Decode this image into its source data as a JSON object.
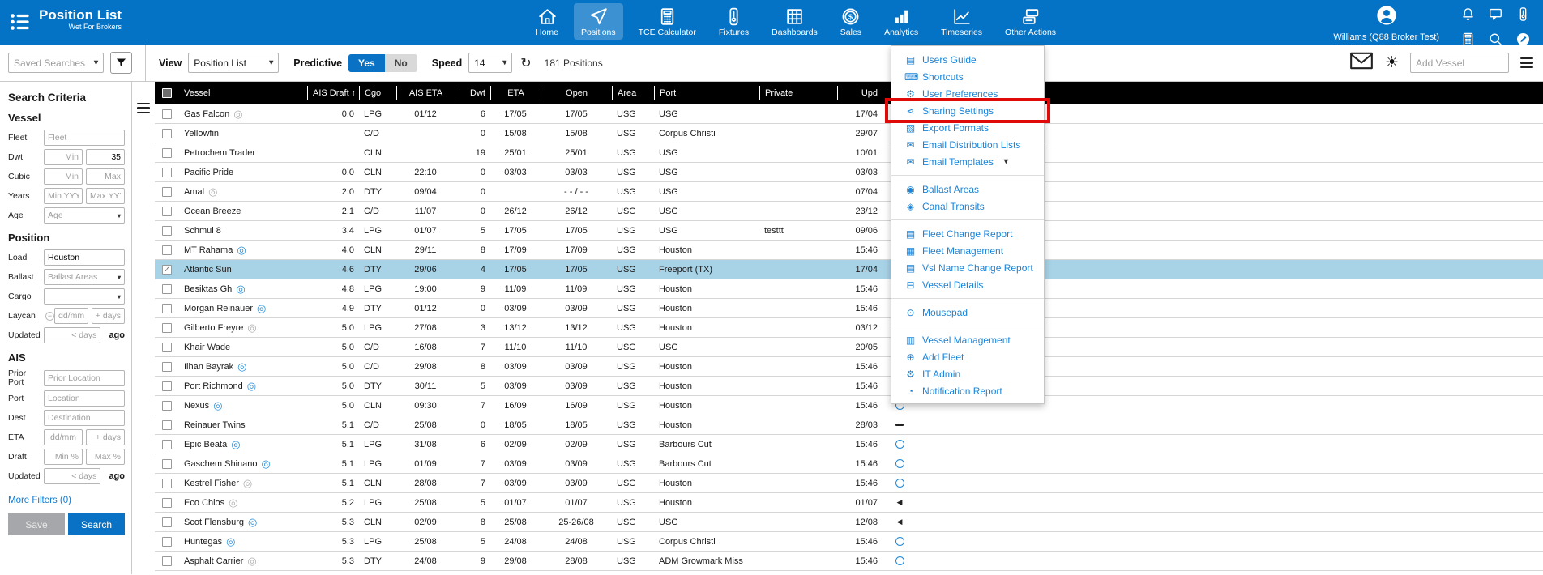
{
  "app": {
    "title": "Position List",
    "subtitle": "Wet For Brokers"
  },
  "nav": {
    "active": "Positions",
    "items": [
      {
        "label": "Home",
        "icon": "home"
      },
      {
        "label": "Positions",
        "icon": "positions"
      },
      {
        "label": "TCE Calculator",
        "icon": "calculator"
      },
      {
        "label": "Fixtures",
        "icon": "fixtures"
      },
      {
        "label": "Dashboards",
        "icon": "dashboards"
      },
      {
        "label": "Sales",
        "icon": "sales"
      },
      {
        "label": "Analytics",
        "icon": "analytics"
      },
      {
        "label": "Timeseries",
        "icon": "timeseries"
      },
      {
        "label": "Other Actions",
        "icon": "other-actions"
      }
    ]
  },
  "user": {
    "name": "Williams (Q88 Broker Test)"
  },
  "toolbar": {
    "saved_searches_placeholder": "Saved Searches",
    "view_label": "View",
    "view_value": "Position List",
    "predictive_label": "Predictive",
    "predictive_yes": "Yes",
    "predictive_no": "No",
    "speed_label": "Speed",
    "speed_value": "14",
    "positions_count": "181 Positions",
    "add_vessel_placeholder": "Add Vessel"
  },
  "sidebar": {
    "title": "Search Criteria",
    "more_filters": "More Filters (0)",
    "save_label": "Save",
    "search_label": "Search",
    "updated_suffix": "ago",
    "sections": [
      {
        "heading": "Vessel",
        "rows": [
          {
            "label": "Fleet",
            "type": "input",
            "placeholder": "Fleet"
          },
          {
            "label": "Dwt",
            "type": "pair",
            "a": {
              "ph": "Min",
              "align": "r"
            },
            "b": {
              "value": "35",
              "align": "r"
            }
          },
          {
            "label": "Cubic",
            "type": "pair",
            "a": {
              "ph": "Min",
              "align": "r"
            },
            "b": {
              "ph": "Max",
              "align": "r"
            }
          },
          {
            "label": "Years",
            "type": "pair",
            "a": {
              "ph": "Min YYYY",
              "align": "c"
            },
            "b": {
              "ph": "Max YYYY",
              "align": "c"
            }
          },
          {
            "label": "Age",
            "type": "select",
            "placeholder": "Age"
          }
        ]
      },
      {
        "heading": "Position",
        "rows": [
          {
            "label": "Load",
            "type": "input",
            "value": "Houston"
          },
          {
            "label": "Ballast",
            "type": "select",
            "placeholder": "Ballast Areas"
          },
          {
            "label": "Cargo",
            "type": "select",
            "placeholder": ""
          },
          {
            "label": "Laycan",
            "type": "pair",
            "badge": "−",
            "a": {
              "ph": "dd/mm",
              "align": "c"
            },
            "b": {
              "ph": "+ days",
              "align": "r"
            }
          },
          {
            "label": "Updated",
            "type": "suffix",
            "a": {
              "ph": "< days",
              "align": "r"
            },
            "suffix": "ago"
          }
        ]
      },
      {
        "heading": "AIS",
        "rows": [
          {
            "label": "Prior Port",
            "type": "input",
            "placeholder": "Prior Location"
          },
          {
            "label": "Port",
            "type": "input",
            "placeholder": "Location"
          },
          {
            "label": "Dest",
            "type": "input",
            "placeholder": "Destination"
          },
          {
            "label": "ETA",
            "type": "pair",
            "a": {
              "ph": "dd/mm",
              "align": "c"
            },
            "b": {
              "ph": "+ days",
              "align": "r"
            }
          },
          {
            "label": "Draft",
            "type": "pair",
            "a": {
              "ph": "Min %",
              "align": "r"
            },
            "b": {
              "ph": "Max %",
              "align": "r"
            }
          },
          {
            "label": "Updated",
            "type": "suffix",
            "a": {
              "ph": "< days",
              "align": "r"
            },
            "suffix": "ago"
          }
        ]
      }
    ]
  },
  "table": {
    "columns": [
      "Vessel",
      "AIS Draft",
      "Cgo",
      "AIS ETA",
      "Dwt",
      "ETA",
      "Open",
      "Area",
      "Port",
      "Private",
      "Upd"
    ],
    "sort_column": "AIS Draft",
    "sort_arrow": "↑",
    "rows": [
      {
        "vessel": "Gas Falcon",
        "live": "grey",
        "draft": "0.0",
        "cgo": "LPG",
        "ais_eta": "01/12",
        "dwt": "6",
        "eta": "17/05",
        "open": "17/05",
        "open_dotted": true,
        "area": "USG",
        "port": "USG",
        "private": "",
        "upd": "17/04",
        "status": "dash",
        "selected": false
      },
      {
        "vessel": "Yellowfin",
        "live": null,
        "draft": "",
        "cgo": "C/D",
        "ais_eta": "",
        "dwt": "0",
        "eta": "15/08",
        "open": "15/08",
        "open_dotted": false,
        "area": "USG",
        "port": "Corpus Christi",
        "private": "",
        "upd": "29/07",
        "status": "dash",
        "selected": false
      },
      {
        "vessel": "Petrochem Trader",
        "live": null,
        "draft": "",
        "cgo": "CLN",
        "ais_eta": "",
        "dwt": "19",
        "eta": "25/01",
        "open": "25/01",
        "open_dotted": false,
        "area": "USG",
        "port": "USG",
        "private": "",
        "upd": "10/01",
        "status": "tri",
        "selected": false
      },
      {
        "vessel": "Pacific Pride",
        "live": null,
        "draft": "0.0",
        "cgo": "CLN",
        "ais_eta": "22:10",
        "dwt": "0",
        "eta": "03/03",
        "open": "03/03",
        "open_dotted": false,
        "area": "USG",
        "port": "USG",
        "private": "",
        "upd": "03/03",
        "status": "tri",
        "selected": false
      },
      {
        "vessel": "Amal",
        "live": "grey",
        "draft": "2.0",
        "cgo": "DTY",
        "ais_eta": "09/04",
        "dwt": "0",
        "eta": "",
        "open": "- - / - -",
        "open_dotted": true,
        "area": "USG",
        "port": "USG",
        "private": "",
        "upd": "07/04",
        "status": "dash",
        "selected": false
      },
      {
        "vessel": "Ocean Breeze",
        "live": null,
        "draft": "2.1",
        "cgo": "C/D",
        "ais_eta": "11/07",
        "dwt": "0",
        "eta": "26/12",
        "open": "26/12",
        "open_dotted": false,
        "area": "USG",
        "port": "USG",
        "private": "",
        "upd": "23/12",
        "status": "tri",
        "selected": false
      },
      {
        "vessel": "Schmui 8",
        "live": null,
        "draft": "3.4",
        "cgo": "LPG",
        "ais_eta": "01/07",
        "dwt": "5",
        "eta": "17/05",
        "open": "17/05",
        "open_dotted": false,
        "area": "USG",
        "port": "USG",
        "private": "testtt",
        "upd": "09/06",
        "status": "dash",
        "selected": false
      },
      {
        "vessel": "MT Rahama",
        "live": "blue",
        "draft": "4.0",
        "cgo": "CLN",
        "ais_eta": "29/11",
        "dwt": "8",
        "eta": "17/09",
        "open": "17/09",
        "open_dotted": true,
        "area": "USG",
        "port": "Houston",
        "private": "",
        "upd": "15:46",
        "status": "circle",
        "selected": false
      },
      {
        "vessel": "Atlantic Sun",
        "live": null,
        "draft": "4.6",
        "cgo": "DTY",
        "ais_eta": "29/06",
        "dwt": "4",
        "eta": "17/05",
        "open": "17/05",
        "open_dotted": false,
        "area": "USG",
        "port": "Freeport (TX)",
        "private": "",
        "upd": "17/04",
        "status": "dash",
        "selected": true
      },
      {
        "vessel": "Besiktas Gh",
        "live": "blue",
        "draft": "4.8",
        "cgo": "LPG",
        "ais_eta": "19:00",
        "dwt": "9",
        "eta": "11/09",
        "open": "11/09",
        "open_dotted": true,
        "area": "USG",
        "port": "Houston",
        "private": "",
        "upd": "15:46",
        "status": "circle",
        "selected": false
      },
      {
        "vessel": "Morgan Reinauer",
        "live": "blue",
        "draft": "4.9",
        "cgo": "DTY",
        "ais_eta": "01/12",
        "dwt": "0",
        "eta": "03/09",
        "open": "03/09",
        "open_dotted": true,
        "area": "USG",
        "port": "Houston",
        "private": "",
        "upd": "15:46",
        "status": "circle",
        "selected": false
      },
      {
        "vessel": "Gilberto Freyre",
        "live": "grey",
        "draft": "5.0",
        "cgo": "LPG",
        "ais_eta": "27/08",
        "dwt": "3",
        "eta": "13/12",
        "open": "13/12",
        "open_dotted": true,
        "area": "USG",
        "port": "Houston",
        "private": "",
        "upd": "03/12",
        "status": "tri",
        "selected": false
      },
      {
        "vessel": "Khair Wade",
        "live": null,
        "draft": "5.0",
        "cgo": "C/D",
        "ais_eta": "16/08",
        "dwt": "7",
        "eta": "11/10",
        "open": "11/10",
        "open_dotted": false,
        "area": "USG",
        "port": "USG",
        "private": "",
        "upd": "20/05",
        "status": "tri",
        "selected": false
      },
      {
        "vessel": "Ilhan Bayrak",
        "live": "blue",
        "draft": "5.0",
        "cgo": "C/D",
        "ais_eta": "29/08",
        "dwt": "8",
        "eta": "03/09",
        "open": "03/09",
        "open_dotted": true,
        "area": "USG",
        "port": "Houston",
        "private": "",
        "upd": "15:46",
        "status": "circle",
        "selected": false
      },
      {
        "vessel": "Port Richmond",
        "live": "blue",
        "draft": "5.0",
        "cgo": "DTY",
        "ais_eta": "30/11",
        "dwt": "5",
        "eta": "03/09",
        "open": "03/09",
        "open_dotted": true,
        "area": "USG",
        "port": "Houston",
        "private": "",
        "upd": "15:46",
        "status": "circle",
        "selected": false
      },
      {
        "vessel": "Nexus",
        "live": "blue",
        "draft": "5.0",
        "cgo": "CLN",
        "ais_eta": "09:30",
        "dwt": "7",
        "eta": "16/09",
        "open": "16/09",
        "open_dotted": true,
        "area": "USG",
        "port": "Houston",
        "private": "",
        "upd": "15:46",
        "status": "circle",
        "selected": false
      },
      {
        "vessel": "Reinauer Twins",
        "live": null,
        "draft": "5.1",
        "cgo": "C/D",
        "ais_eta": "25/08",
        "dwt": "0",
        "eta": "18/05",
        "open": "18/05",
        "open_dotted": false,
        "area": "USG",
        "port": "Houston",
        "private": "",
        "upd": "28/03",
        "status": "dash",
        "selected": false
      },
      {
        "vessel": "Epic Beata",
        "live": "blue",
        "draft": "5.1",
        "cgo": "LPG",
        "ais_eta": "31/08",
        "dwt": "6",
        "eta": "02/09",
        "open": "02/09",
        "open_dotted": true,
        "area": "USG",
        "port": "Barbours Cut",
        "private": "",
        "upd": "15:46",
        "status": "circle",
        "selected": false
      },
      {
        "vessel": "Gaschem Shinano",
        "live": "blue",
        "draft": "5.1",
        "cgo": "LPG",
        "ais_eta": "01/09",
        "dwt": "7",
        "eta": "03/09",
        "open": "03/09",
        "open_dotted": true,
        "area": "USG",
        "port": "Barbours Cut",
        "private": "",
        "upd": "15:46",
        "status": "circle",
        "selected": false
      },
      {
        "vessel": "Kestrel Fisher",
        "live": "grey",
        "draft": "5.1",
        "cgo": "CLN",
        "ais_eta": "28/08",
        "dwt": "7",
        "eta": "03/09",
        "open": "03/09",
        "open_dotted": true,
        "area": "USG",
        "port": "Houston",
        "private": "",
        "upd": "15:46",
        "status": "circle",
        "selected": false
      },
      {
        "vessel": "Eco Chios",
        "live": "grey",
        "draft": "5.2",
        "cgo": "LPG",
        "ais_eta": "25/08",
        "dwt": "5",
        "eta": "01/07",
        "open": "01/07",
        "open_dotted": true,
        "area": "USG",
        "port": "Houston",
        "private": "",
        "upd": "01/07",
        "status": "tri",
        "selected": false
      },
      {
        "vessel": "Scot Flensburg",
        "live": "blue",
        "draft": "5.3",
        "cgo": "CLN",
        "ais_eta": "02/09",
        "dwt": "8",
        "eta": "25/08",
        "open": "25-26/08",
        "open_dotted": true,
        "area": "USG",
        "port": "USG",
        "private": "",
        "upd": "12/08",
        "status": "tri",
        "selected": false
      },
      {
        "vessel": "Huntegas",
        "live": "blue",
        "draft": "5.3",
        "cgo": "LPG",
        "ais_eta": "25/08",
        "dwt": "5",
        "eta": "24/08",
        "open": "24/08",
        "open_dotted": false,
        "area": "USG",
        "port": "Corpus Christi",
        "private": "",
        "upd": "15:46",
        "status": "circle",
        "selected": false
      },
      {
        "vessel": "Asphalt Carrier",
        "live": "grey",
        "draft": "5.3",
        "cgo": "DTY",
        "ais_eta": "24/08",
        "dwt": "9",
        "eta": "29/08",
        "open": "28/08",
        "open_dotted": true,
        "area": "USG",
        "port": "ADM Growmark Miss",
        "private": "",
        "upd": "15:46",
        "status": "circle",
        "selected": false
      }
    ]
  },
  "menu": {
    "highlighted": "Sharing Settings",
    "groups": [
      {
        "items": [
          {
            "label": "Users Guide",
            "name": "users-guide",
            "icon": "▤"
          },
          {
            "label": "Shortcuts",
            "name": "shortcuts",
            "icon": "⌨"
          },
          {
            "label": "User Preferences",
            "name": "user-preferences",
            "icon": "⚙"
          },
          {
            "label": "Sharing Settings",
            "name": "sharing-settings",
            "icon": "⋖"
          },
          {
            "label": "Export Formats",
            "name": "export-formats",
            "icon": "▧"
          },
          {
            "label": "Email Distribution Lists",
            "name": "email-distribution-lists",
            "icon": "✉"
          },
          {
            "label": "Email Templates",
            "name": "email-templates",
            "icon": "✉",
            "caret": "▾"
          }
        ]
      },
      {
        "items": [
          {
            "label": "Ballast Areas",
            "name": "ballast-areas",
            "icon": "◉"
          },
          {
            "label": "Canal Transits",
            "name": "canal-transits",
            "icon": "◈"
          }
        ]
      },
      {
        "items": [
          {
            "label": "Fleet Change Report",
            "name": "fleet-change-report",
            "icon": "▤"
          },
          {
            "label": "Fleet Management",
            "name": "fleet-management",
            "icon": "▦"
          },
          {
            "label": "Vsl Name Change Report",
            "name": "vsl-name-change-report",
            "icon": "▤"
          },
          {
            "label": "Vessel Details",
            "name": "vessel-details",
            "icon": "⊟"
          }
        ]
      },
      {
        "items": [
          {
            "label": "Mousepad",
            "name": "mousepad",
            "icon": "⊙"
          }
        ]
      },
      {
        "items": [
          {
            "label": "Vessel Management",
            "name": "vessel-management",
            "icon": "▥"
          },
          {
            "label": "Add Fleet",
            "name": "add-fleet",
            "icon": "⊕"
          },
          {
            "label": "IT Admin",
            "name": "it-admin",
            "icon": "⚙"
          },
          {
            "label": "Notification Report",
            "name": "notification-report",
            "icon": "◔"
          }
        ]
      }
    ]
  }
}
